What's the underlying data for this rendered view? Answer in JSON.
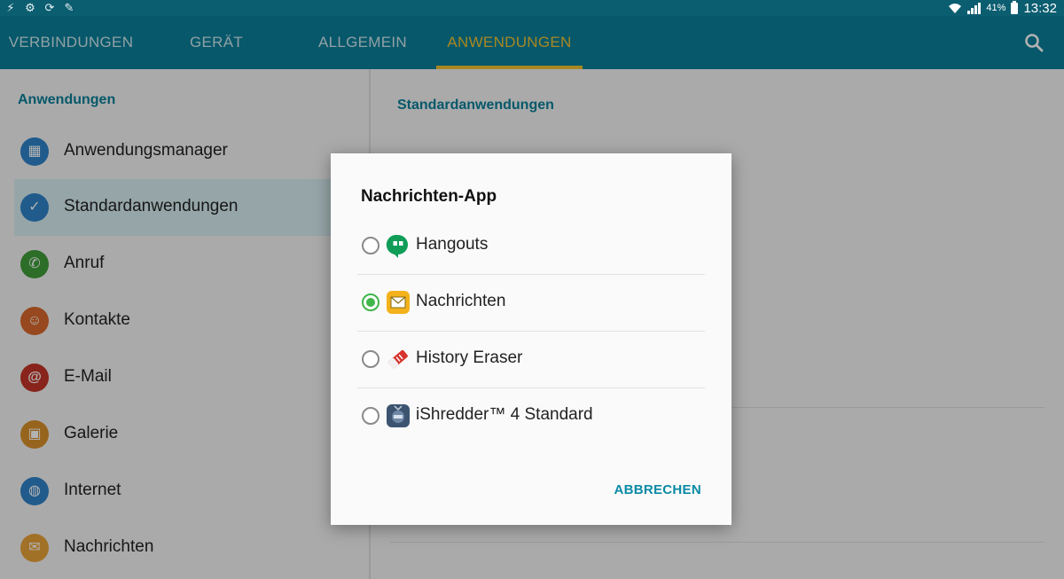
{
  "status_bar": {
    "battery_percent": "41%",
    "time": "13:32",
    "left_icons": [
      "flash-icon",
      "settings-gear-icon",
      "sync-icon",
      "clean-icon"
    ]
  },
  "tabs": [
    {
      "label": "VERBINDUNGEN",
      "active": false
    },
    {
      "label": "GERÄT",
      "active": false
    },
    {
      "label": "ALLGEMEIN",
      "active": false
    },
    {
      "label": "ANWENDUNGEN",
      "active": true
    }
  ],
  "left_panel": {
    "section_title": "Anwendungen",
    "items": [
      {
        "label": "Anwendungsmanager",
        "icon": "grid-icon",
        "color": "#2f83c9",
        "selected": false
      },
      {
        "label": "Standardanwendungen",
        "icon": "grid-check-icon",
        "color": "#2f83c9",
        "selected": true
      },
      {
        "label": "Anruf",
        "icon": "phone-icon",
        "color": "#3f9c3a",
        "selected": false
      },
      {
        "label": "Kontakte",
        "icon": "contact-icon",
        "color": "#d9682b",
        "selected": false
      },
      {
        "label": "E-Mail",
        "icon": "at-icon",
        "color": "#c33427",
        "selected": false
      },
      {
        "label": "Galerie",
        "icon": "gallery-icon",
        "color": "#d9902b",
        "selected": false
      },
      {
        "label": "Internet",
        "icon": "globe-icon",
        "color": "#2f83c9",
        "selected": false
      },
      {
        "label": "Nachrichten",
        "icon": "message-icon",
        "color": "#e8a23a",
        "selected": false
      }
    ]
  },
  "right_panel": {
    "section_title": "Standardanwendungen"
  },
  "dialog": {
    "title": "Nachrichten-App",
    "options": [
      {
        "label": "Hangouts",
        "icon": "hangouts-icon",
        "checked": false
      },
      {
        "label": "Nachrichten",
        "icon": "messages-app-icon",
        "checked": true
      },
      {
        "label": "History Eraser",
        "icon": "eraser-icon",
        "checked": false
      },
      {
        "label": "iShredder™ 4 Standard",
        "icon": "shredder-icon",
        "checked": false
      }
    ],
    "cancel_label": "ABBRECHEN"
  },
  "colors": {
    "accent": "#0a7e98",
    "active_tab": "#f1c232",
    "radio_checked": "#3fb54a"
  }
}
